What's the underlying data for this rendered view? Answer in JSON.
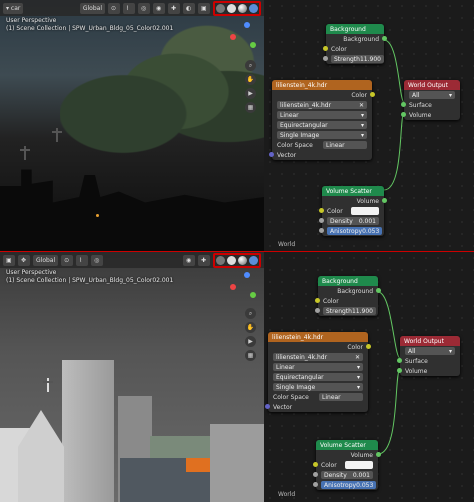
{
  "colors": {
    "highlight": "#cc0000",
    "shader": "#63c763",
    "texture": "#e87d0d",
    "output": "#cc3340",
    "node_bg": "#303030",
    "float_socket": "#a1a1a1",
    "color_socket": "#c7c729",
    "shader_socket": "#63c763",
    "vector_socket": "#6363c7"
  },
  "top": {
    "header": {
      "object": "car",
      "orientation": "Global"
    },
    "overlay": {
      "line1": "User Perspective",
      "line2": "(1) Scene Collection | SPW_Urban_Bldg_05_Color02.001"
    },
    "nodes": {
      "background": {
        "title": "Background",
        "output": "Background",
        "color_label": "Color",
        "strength_label": "Strength",
        "strength_value": "11.900"
      },
      "env": {
        "title": "lilienstein_4k.hdr",
        "output": "Color",
        "file": "lilienstein_4k.hdr",
        "interp": "Linear",
        "proj": "Equirectangular",
        "ext": "Single Image",
        "cs_label": "Color Space",
        "cs_value": "Linear",
        "vector_label": "Vector"
      },
      "world_out": {
        "title": "World Output",
        "target": "All",
        "surface": "Surface",
        "volume": "Volume"
      },
      "vol": {
        "title": "Volume Scatter",
        "output": "Volume",
        "color_label": "Color",
        "density_label": "Density",
        "density_value": "0.001",
        "aniso_label": "Anisotropy",
        "aniso_value": "0.053"
      }
    },
    "world_label": "World"
  },
  "bottom": {
    "header": {
      "orientation": "Global"
    },
    "overlay": {
      "line1": "User Perspective",
      "line2": "(1) Scene Collection | SPW_Urban_Bldg_05_Color02.001"
    },
    "nodes": {
      "background": {
        "title": "Background",
        "output": "Background",
        "color_label": "Color",
        "strength_label": "Strength",
        "strength_value": "11.900"
      },
      "env": {
        "title": "lilienstein_4k.hdr",
        "output": "Color",
        "file": "lilienstein_4k.hdr",
        "interp": "Linear",
        "proj": "Equirectangular",
        "ext": "Single Image",
        "cs_label": "Color Space",
        "cs_value": "Linear",
        "vector_label": "Vector"
      },
      "world_out": {
        "title": "World Output",
        "target": "All",
        "surface": "Surface",
        "volume": "Volume"
      },
      "vol": {
        "title": "Volume Scatter",
        "output": "Volume",
        "color_label": "Color",
        "density_label": "Density",
        "density_value": "0.001",
        "aniso_label": "Anisotropy",
        "aniso_value": "0.053"
      }
    },
    "world_label": "World"
  }
}
